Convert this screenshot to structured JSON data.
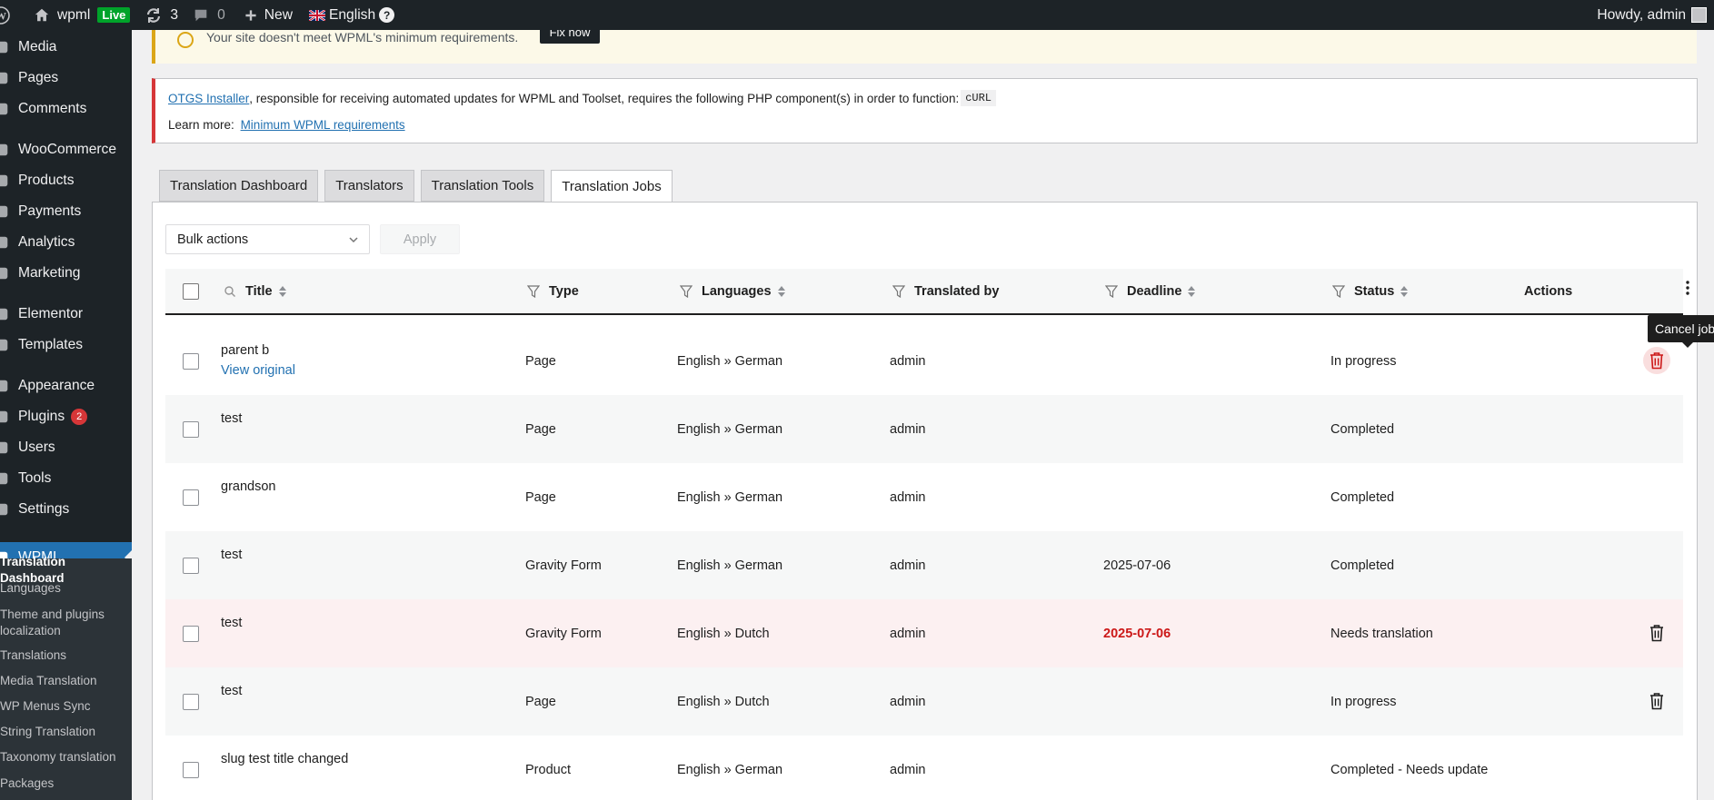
{
  "adminbar": {
    "site_name": "wpml",
    "live_label": "Live",
    "updates_count": "3",
    "comments_count": "0",
    "new_label": "New",
    "language_label": "English",
    "help_glyph": "?",
    "howdy": "Howdy, admin"
  },
  "sidebar": {
    "items": [
      {
        "label": "Media",
        "icon": "media-icon"
      },
      {
        "label": "Pages",
        "icon": "pages-icon"
      },
      {
        "label": "Comments",
        "icon": "comments-icon"
      },
      {
        "label": "WooCommerce",
        "icon": "woocommerce-icon"
      },
      {
        "label": "Products",
        "icon": "products-icon"
      },
      {
        "label": "Payments",
        "icon": "payments-icon"
      },
      {
        "label": "Analytics",
        "icon": "analytics-icon"
      },
      {
        "label": "Marketing",
        "icon": "marketing-icon"
      },
      {
        "label": "Elementor",
        "icon": "elementor-icon"
      },
      {
        "label": "Templates",
        "icon": "templates-icon"
      },
      {
        "label": "Appearance",
        "icon": "appearance-icon"
      },
      {
        "label": "Plugins",
        "icon": "plugins-icon",
        "badge": "2"
      },
      {
        "label": "Users",
        "icon": "users-icon"
      },
      {
        "label": "Tools",
        "icon": "tools-icon"
      },
      {
        "label": "Settings",
        "icon": "settings-icon"
      },
      {
        "label": "WPML",
        "icon": "wpml-icon",
        "active": true
      }
    ],
    "submenu": [
      "Translation Dashboard",
      "Languages",
      "Theme and plugins localization",
      "Translations",
      "Media Translation",
      "WP Menus Sync",
      "String Translation",
      "Taxonomy translation",
      "Packages"
    ]
  },
  "notices": {
    "top_text": "Your site doesn't meet WPML's minimum requirements.",
    "fix_button": "Fix now",
    "error_link": "OTGS Installer",
    "error_text": ", responsible for receiving automated updates for WPML and Toolset, requires the following PHP component(s) in order to function:",
    "error_code": "cURL",
    "learn_more_prefix": "Learn more:",
    "learn_more_link": "Minimum WPML requirements"
  },
  "tabs": [
    "Translation Dashboard",
    "Translators",
    "Translation Tools",
    "Translation Jobs"
  ],
  "active_tab": "Translation Jobs",
  "toolbar": {
    "bulk_actions": "Bulk actions",
    "apply": "Apply"
  },
  "table": {
    "columns": {
      "title": "Title",
      "type": "Type",
      "languages": "Languages",
      "translated_by": "Translated by",
      "deadline": "Deadline",
      "status": "Status",
      "actions": "Actions"
    },
    "rows": [
      {
        "title": "parent b",
        "link": "View original",
        "type": "Page",
        "languages": "English » German",
        "translated_by": "admin",
        "deadline": "",
        "status": "In progress",
        "trash": true
      },
      {
        "title": "test",
        "type": "Page",
        "languages": "English » German",
        "translated_by": "admin",
        "deadline": "",
        "status": "Completed"
      },
      {
        "title": "grandson",
        "type": "Page",
        "languages": "English » German",
        "translated_by": "admin",
        "deadline": "",
        "status": "Completed"
      },
      {
        "title": "test",
        "type": "Gravity Form",
        "languages": "English » German",
        "translated_by": "admin",
        "deadline": "2025-07-06",
        "status": "Completed"
      },
      {
        "title": "test",
        "type": "Gravity Form",
        "languages": "English » Dutch",
        "translated_by": "admin",
        "deadline": "2025-07-06",
        "status": "Needs translation",
        "trash": true,
        "overdue": true
      },
      {
        "title": "test",
        "type": "Page",
        "languages": "English » Dutch",
        "translated_by": "admin",
        "deadline": "",
        "status": "In progress",
        "trash": true
      },
      {
        "title": "slug test title changed",
        "type": "Product",
        "languages": "English » German",
        "translated_by": "admin",
        "deadline": "",
        "status": "Completed - Needs update"
      }
    ],
    "tooltip": "Cancel job"
  },
  "colors": {
    "accent": "#2271b1",
    "sidebar": "#1d2327",
    "danger": "#cc1818",
    "warn_row": "#fcf0f1"
  }
}
